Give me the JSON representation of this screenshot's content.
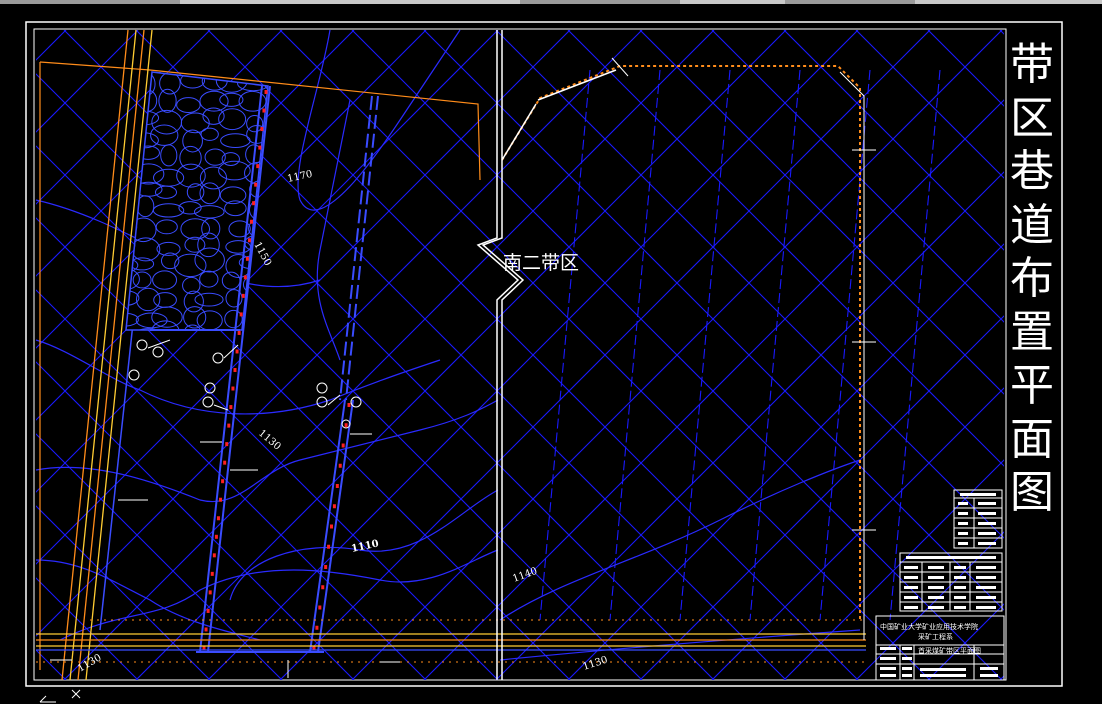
{
  "title_chars": [
    "带",
    "区",
    "巷",
    "道",
    "布",
    "置",
    "平",
    "面",
    "图"
  ],
  "zone_label": "南二带区",
  "contours": {
    "c1170": "1170",
    "c1150": "1150",
    "c1130": "1130",
    "c1110": "1110",
    "c1140": "1140",
    "c1130b": "1130",
    "c1130c": "1130"
  },
  "title_block": {
    "school_line1": "中国矿业大学矿业应用技术学院",
    "school_line2": "采矿工程系",
    "drawing_name": "首采煤矿带区平面图"
  },
  "colors": {
    "grid": "#1a1aff",
    "boundary": "#ff8c1a",
    "roadway": "#3a4cff",
    "marker": "#ff2020",
    "frame": "#ffffff"
  }
}
